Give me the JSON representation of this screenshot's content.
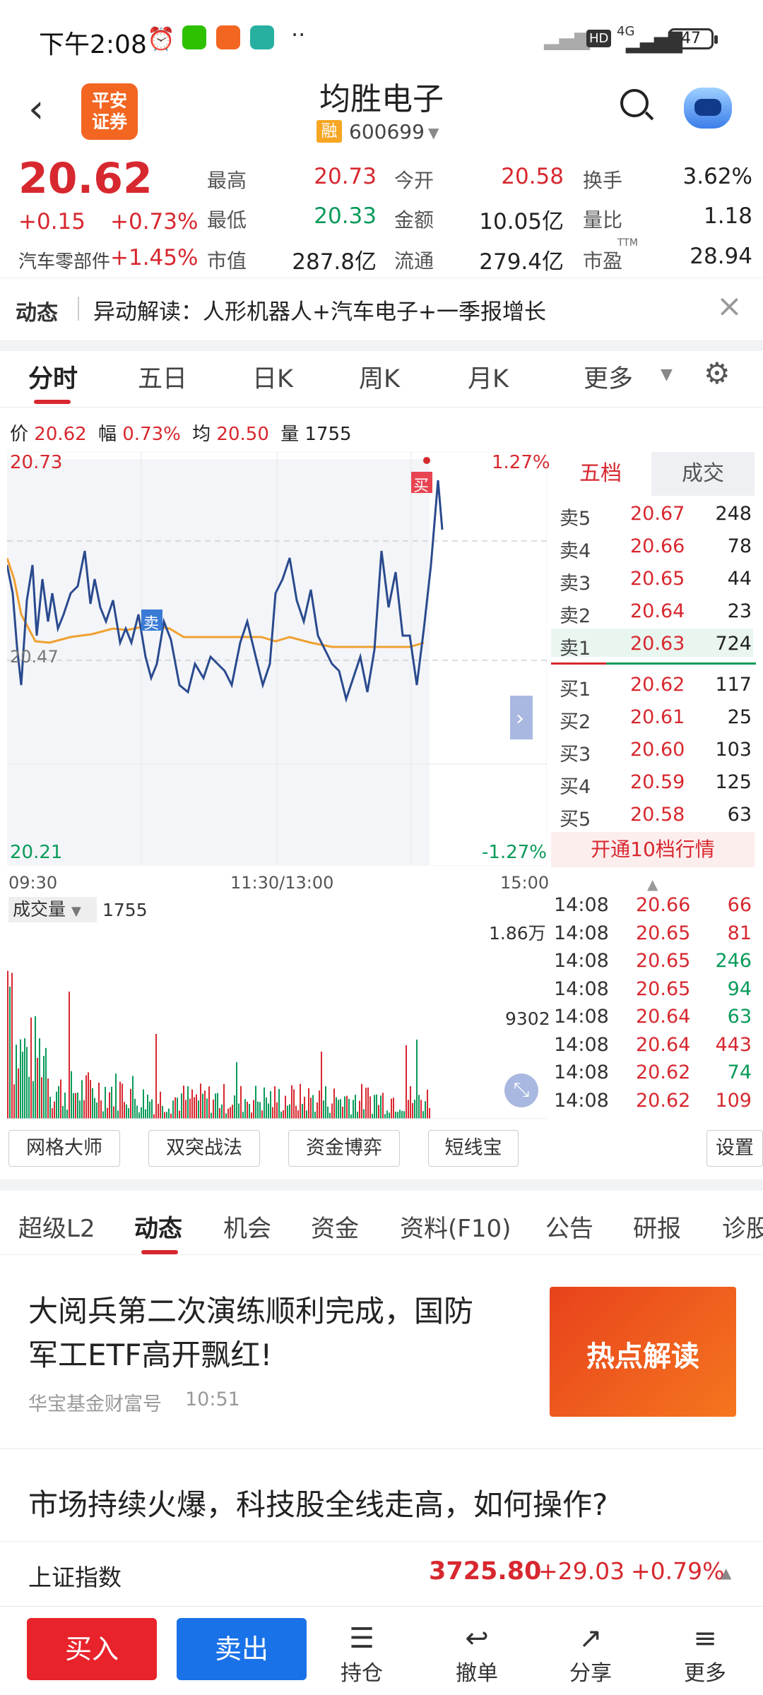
{
  "status_bar": {
    "time": "下午2:08",
    "net": "4G",
    "battery": "47",
    "hd": "HD"
  },
  "header": {
    "logo_line1": "平安",
    "logo_line2": "证券",
    "stock_name": "均胜电子",
    "margin_badge": "融",
    "stock_code": "600699"
  },
  "quote": {
    "price": "20.62",
    "change": "+0.15",
    "change_pct": "+0.73%",
    "sector": "汽车零部件",
    "sector_pct": "+1.45%",
    "high_label": "最高",
    "high": "20.73",
    "low_label": "最低",
    "low": "20.33",
    "mktcap_label": "市值",
    "mktcap": "287.8亿",
    "open_label": "今开",
    "open": "20.58",
    "amount_label": "金额",
    "amount": "10.05亿",
    "float_label": "流通",
    "float": "279.4亿",
    "turnover_label": "换手",
    "turnover": "3.62%",
    "vol_ratio_label": "量比",
    "vol_ratio": "1.18",
    "pe_label": "市盈",
    "pe_sup": "TTM",
    "pe": "28.94"
  },
  "dynamic": {
    "label": "动态",
    "text": "异动解读：人形机器人+汽车电子+一季报增长"
  },
  "chart_tabs": [
    "分时",
    "五日",
    "日K",
    "周K",
    "月K",
    "更多"
  ],
  "chart_info": {
    "price_label": "价",
    "price": "20.62",
    "amp_label": "幅",
    "amp": "0.73%",
    "avg_label": "均",
    "avg": "20.50",
    "vol_label": "量",
    "vol": "1755"
  },
  "chart_labels": {
    "top_price": "20.73",
    "top_pct": "1.27%",
    "mid_price": "20.47",
    "bottom_price": "20.21",
    "bottom_pct": "-1.27%",
    "t_start": "09:30",
    "t_mid": "11:30/13:00",
    "t_end": "15:00",
    "buy_marker": "买",
    "sell_marker": "卖"
  },
  "volume": {
    "label": "成交量",
    "value": "1755",
    "max": "1.86万",
    "mid": "9302"
  },
  "orderbook": {
    "tab_active": "五档",
    "tab_other": "成交",
    "asks": [
      {
        "l": "卖5",
        "p": "20.67",
        "v": "248"
      },
      {
        "l": "卖4",
        "p": "20.66",
        "v": "78"
      },
      {
        "l": "卖3",
        "p": "20.65",
        "v": "44"
      },
      {
        "l": "卖2",
        "p": "20.64",
        "v": "23"
      },
      {
        "l": "卖1",
        "p": "20.63",
        "v": "724"
      }
    ],
    "bids": [
      {
        "l": "买1",
        "p": "20.62",
        "v": "117"
      },
      {
        "l": "买2",
        "p": "20.61",
        "v": "25"
      },
      {
        "l": "买3",
        "p": "20.60",
        "v": "103"
      },
      {
        "l": "买4",
        "p": "20.59",
        "v": "125"
      },
      {
        "l": "买5",
        "p": "20.58",
        "v": "63"
      }
    ],
    "level10_btn": "开通10档行情"
  },
  "trades": [
    {
      "t": "14:08",
      "p": "20.66",
      "v": "66"
    },
    {
      "t": "14:08",
      "p": "20.65",
      "v": "81"
    },
    {
      "t": "14:08",
      "p": "20.65",
      "v": "246"
    },
    {
      "t": "14:08",
      "p": "20.65",
      "v": "94"
    },
    {
      "t": "14:08",
      "p": "20.64",
      "v": "63"
    },
    {
      "t": "14:08",
      "p": "20.64",
      "v": "443"
    },
    {
      "t": "14:08",
      "p": "20.62",
      "v": "74"
    },
    {
      "t": "14:08",
      "p": "20.62",
      "v": "109"
    }
  ],
  "tools": [
    "网格大师",
    "双突战法",
    "资金博弈",
    "短线宝"
  ],
  "tools_settings": "设置",
  "info_tabs": [
    "超级L2",
    "动态",
    "机会",
    "资金",
    "资料(F10)",
    "公告",
    "研报",
    "诊股"
  ],
  "news": [
    {
      "title_line1": "大阅兵第二次演练顺利完成，国防",
      "title_line2": "军工ETF高开飘红!",
      "source": "华宝基金财富号",
      "time": "10:51",
      "banner": "热点解读"
    },
    {
      "title": "市场持续火爆，科技股全线走高，如何操作?"
    }
  ],
  "index_bar": {
    "name": "上证指数",
    "value": "3725.80",
    "change": "+29.03",
    "pct": "+0.79%"
  },
  "bottom": {
    "buy": "买入",
    "sell": "卖出",
    "hold": "持仓",
    "cancel": "撤单",
    "share": "分享",
    "more": "更多"
  },
  "colors": {
    "up": "#d7282f",
    "down": "#0a9a5a",
    "brand": "#f26622",
    "buy_btn": "#e8232b",
    "sell_btn": "#1a72e8"
  }
}
